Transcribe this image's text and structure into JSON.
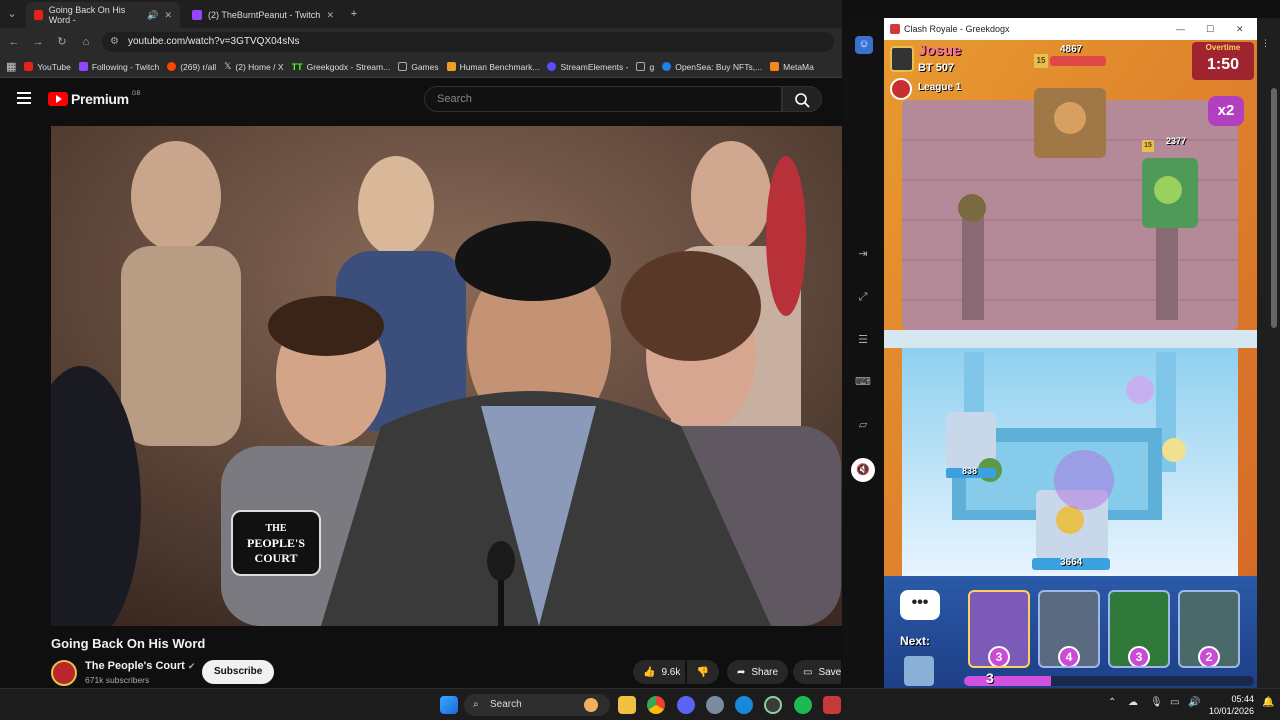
{
  "browser": {
    "tabs": [
      {
        "label": "Going Back On His Word -",
        "active": true,
        "color": "#e62117"
      },
      {
        "label": "(2) TheBurntPeanut - Twitch",
        "active": false,
        "color": "#9147ff"
      }
    ],
    "url": "youtube.com/watch?v=3GTVQX04sNs",
    "bookmarks": [
      {
        "label": "YouTube",
        "color": "#e62117"
      },
      {
        "label": "Following - Twitch",
        "color": "#9147ff"
      },
      {
        "label": "(269) r/all",
        "color": "#ff4500"
      },
      {
        "label": "(2) Home / X",
        "color": "#ffffff"
      },
      {
        "label": "Greekgodx - Stream...",
        "color": "#53fc18"
      },
      {
        "label": "Games",
        "color": "#888888"
      },
      {
        "label": "Human Benchmark...",
        "color": "#f0a020"
      },
      {
        "label": "StreamElements -",
        "color": "#5b4cff"
      },
      {
        "label": "g",
        "color": "#888888"
      },
      {
        "label": "OpenSea: Buy NFTs,...",
        "color": "#2081e2"
      },
      {
        "label": "MetaMa",
        "color": "#f6851b"
      }
    ]
  },
  "youtube": {
    "logo_text": "Premium",
    "logo_sup": "GB",
    "search_placeholder": "Search",
    "video": {
      "overlay_logo": [
        "THE",
        "PEOPLE'S",
        "COURT"
      ]
    },
    "title": "Going Back On His Word",
    "channel": {
      "name": "The People's Court",
      "subscribers": "671k subscribers",
      "subscribe_label": "Subscribe"
    },
    "actions": {
      "likes": "9.6k",
      "share_label": "Share",
      "save_label": "Save"
    }
  },
  "clash": {
    "window_title": "Clash Royale - Greekdogx",
    "opponent": {
      "name": "Josue",
      "trophies": "BT 507",
      "league": "League 1",
      "level": "15"
    },
    "overtime_label": "Overtime",
    "timer": "1:50",
    "multiplier": "x2",
    "enemy_king_hp": "4867",
    "enemy_princess_hp": "2377",
    "friendly_princess_hp": "838",
    "friendly_king_hp": "3664",
    "next_label": "Next:",
    "cards": [
      {
        "cost": "3",
        "color": "#7c5ab8"
      },
      {
        "cost": "4",
        "color": "#5a6a80"
      },
      {
        "cost": "3",
        "color": "#2f7a3a"
      },
      {
        "cost": "2",
        "color": "#4a6a6a"
      }
    ],
    "elixir": "3",
    "elixir_fraction": 0.3
  },
  "taskbar": {
    "search_label": "Search",
    "time": "05:44",
    "date": "10/01/2026"
  }
}
